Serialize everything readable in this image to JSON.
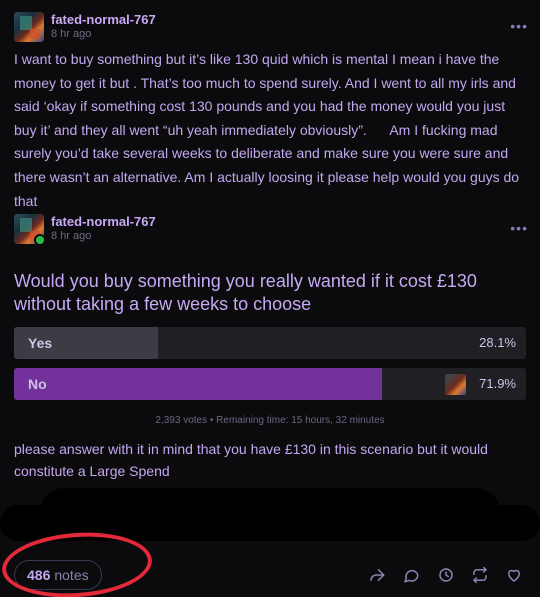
{
  "post1": {
    "username": "fated-normal-767",
    "timestamp": "8 hr ago",
    "more_label": "•••",
    "body": "I want to buy something but it’s like 130 quid which is mental I mean i have the money to get it but . That’s too much to spend surely. And I went to all my irls and said ‘okay if something cost 130 pounds and you had the money would you just buy it’ and they all went “uh yeah immediately obviously”.      Am I fucking mad surely you’d take several weeks to deliberate and make sure you were sure and there wasn’t an alternative. Am I actually loosing it please help would you guys do that"
  },
  "post2": {
    "username": "fated-normal-767",
    "timestamp": "8 hr ago",
    "more_label": "•••",
    "question": "Would you buy something you really wanted if it cost £130 without taking a few weeks to choose",
    "poll": {
      "options": [
        {
          "label": "Yes",
          "percent_text": "28.1%",
          "fraction": 0.281,
          "fill_color": "#3c3c44"
        },
        {
          "label": "No",
          "percent_text": "71.9%",
          "fraction": 0.719,
          "fill_color": "#73329b"
        }
      ],
      "info": "2,393 votes • Remaining time: 15 hours, 32 minutes"
    },
    "footer_text": "please answer with it in mind that you have £130 in this scenario but it would constitute a Large Spend"
  },
  "footer": {
    "notes_count": "486",
    "notes_label": "notes",
    "actions": [
      "share-icon",
      "reply-icon",
      "history-icon",
      "reblog-icon",
      "like-icon"
    ]
  },
  "colors": {
    "background": "#0b0b0d",
    "text": "#c3a7f0",
    "accent": "#73329b",
    "annotation_circle": "#e4293a"
  }
}
